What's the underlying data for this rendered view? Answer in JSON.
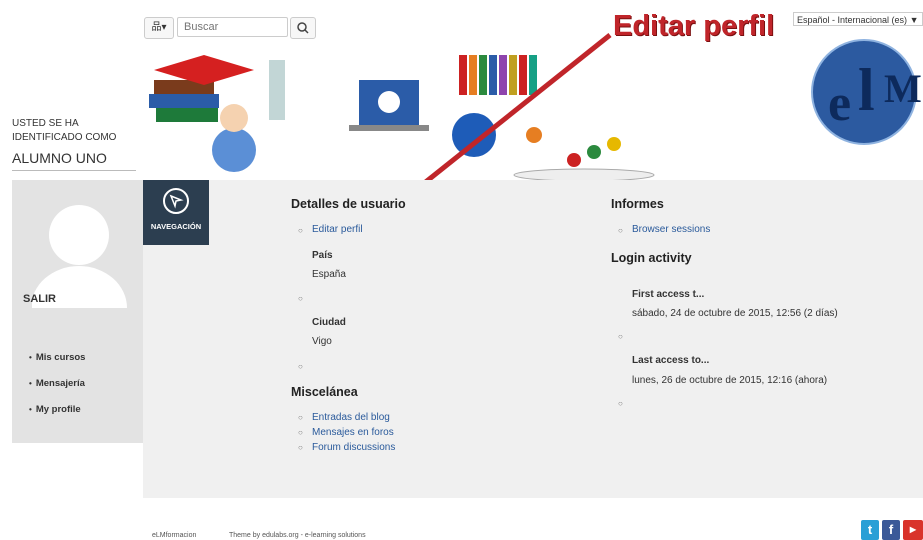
{
  "header": {
    "nav_icon": "sitemap-icon",
    "search_placeholder": "Buscar",
    "search_icon": "search-icon",
    "language": "Español - Internacional (es)",
    "annotation": "Editar perfil"
  },
  "user": {
    "logged_label": "USTED SE HA IDENTIFICADO COMO",
    "name": "ALUMNO UNO",
    "logout": "SALIR",
    "menu": [
      "Mis cursos",
      "Mensajería",
      "My profile"
    ]
  },
  "nav_tab": "NAVEGACIÓN",
  "details": {
    "heading": "Detalles de usuario",
    "edit_link": "Editar perfil",
    "country_label": "País",
    "country_value": "España",
    "city_label": "Ciudad",
    "city_value": "Vigo"
  },
  "misc": {
    "heading": "Miscelánea",
    "links": [
      "Entradas del blog",
      "Mensajes en foros",
      "Forum discussions"
    ]
  },
  "reports": {
    "heading": "Informes",
    "link": "Browser sessions"
  },
  "login": {
    "heading": "Login activity",
    "first_label": "First access t...",
    "first_value": "sábado, 24 de octubre de 2015, 12:56  (2 días)",
    "last_label": "Last access to...",
    "last_value": "lunes, 26 de octubre de 2015, 12:16  (ahora)"
  },
  "footer": {
    "site": "eLMformacion",
    "theme": "Theme by edulabs.org - e-learning solutions",
    "social": [
      "twitter-icon",
      "facebook-icon",
      "youtube-icon"
    ]
  },
  "colors": {
    "accent": "#2c3e50",
    "link": "#2a5a9b",
    "annotation": "#c0252a"
  }
}
